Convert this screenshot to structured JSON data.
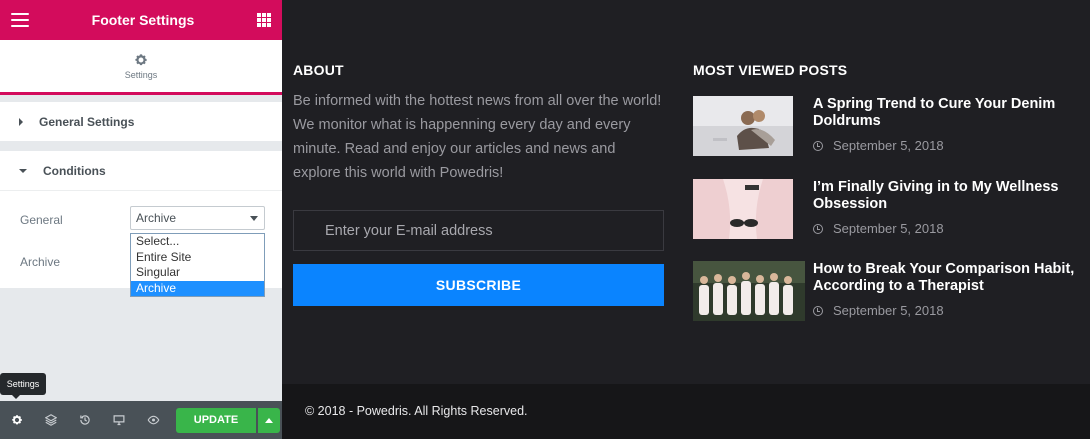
{
  "panel": {
    "title": "Footer Settings",
    "tab_label": "Settings",
    "sections": {
      "general": "General Settings",
      "conditions": "Conditions"
    },
    "conditions": {
      "general_label": "General",
      "archive_label": "Archive",
      "select_value": "Archive",
      "options": [
        "Select...",
        "Entire Site",
        "Singular",
        "Archive"
      ],
      "selected_option": "Archive"
    },
    "tooltip": "Settings",
    "update_label": "UPDATE",
    "colors": {
      "header": "#d30c5c",
      "update": "#39b54a",
      "footer": "#495157"
    }
  },
  "footer": {
    "about": {
      "title": "ABOUT",
      "text": "Be informed with the hottest news from all over the world! We monitor what is happenning every day and every minute. Read and enjoy our articles and news and explore this world with Powedris!",
      "email_placeholder": "Enter your E-mail address",
      "subscribe_label": "SUBSCRIBE"
    },
    "most_viewed": {
      "title": "MOST VIEWED POSTS",
      "posts": [
        {
          "title": "A Spring Trend to Cure Your Denim Doldrums",
          "date": "September 5, 2018"
        },
        {
          "title": "I’m Finally Giving in to My Wellness Obsession",
          "date": "September 5, 2018"
        },
        {
          "title": "How to Break Your Comparison Habit, According to a Therapist",
          "date": "September 5, 2018"
        }
      ]
    },
    "copyright": "© 2018 - Powedris. All Rights Reserved.",
    "colors": {
      "background": "#1f1f23",
      "accent": "#0a84ff",
      "bottom_bar": "#161618"
    }
  }
}
